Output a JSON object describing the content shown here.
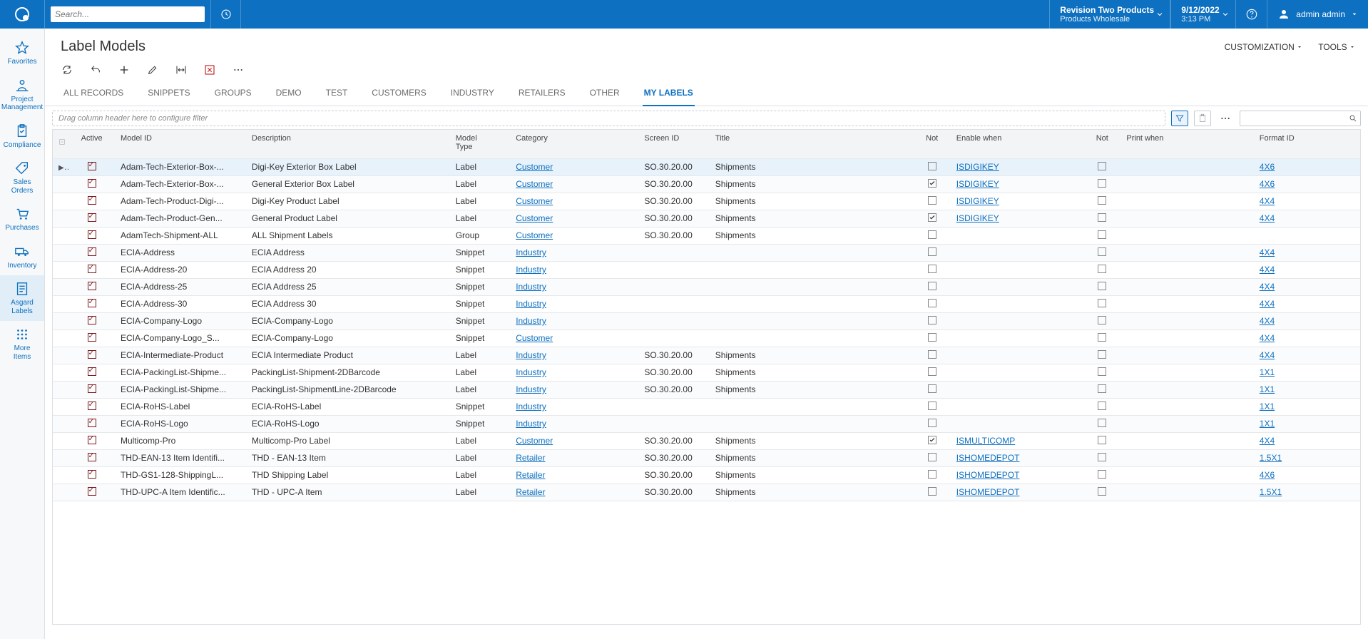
{
  "top": {
    "search_placeholder": "Search...",
    "company_line1": "Revision Two Products",
    "company_line2": "Products Wholesale",
    "date": "9/12/2022",
    "time": "3:13 PM",
    "user": "admin admin"
  },
  "sidebar": [
    {
      "label": "Favorites",
      "icon": "star"
    },
    {
      "label": "Project Management",
      "icon": "pm"
    },
    {
      "label": "Compliance",
      "icon": "clip"
    },
    {
      "label": "Sales Orders",
      "icon": "tag"
    },
    {
      "label": "Purchases",
      "icon": "cart"
    },
    {
      "label": "Inventory",
      "icon": "truck"
    },
    {
      "label": "Asgard Labels",
      "icon": "doc",
      "active": true
    },
    {
      "label": "More Items",
      "icon": "grid"
    }
  ],
  "page": {
    "title": "Label Models",
    "actions": {
      "customization": "CUSTOMIZATION",
      "tools": "TOOLS"
    },
    "tabs": [
      "ALL RECORDS",
      "SNIPPETS",
      "GROUPS",
      "DEMO",
      "TEST",
      "CUSTOMERS",
      "INDUSTRY",
      "RETAILERS",
      "OTHER",
      "MY LABELS"
    ],
    "active_tab": 9,
    "drag_hint": "Drag column header here to configure filter"
  },
  "columns": [
    "",
    "Active",
    "Model ID",
    "Description",
    "Model Type",
    "Category",
    "Screen ID",
    "Title",
    "Not",
    "Enable when",
    "Not",
    "Print when",
    "Format ID"
  ],
  "rows": [
    {
      "active": true,
      "model_id": "Adam-Tech-Exterior-Box-...",
      "desc": "Digi-Key Exterior Box Label",
      "type": "Label",
      "category": "Customer",
      "screen": "SO.30.20.00",
      "title": "Shipments",
      "not1": false,
      "enable": "ISDIGIKEY",
      "not2": false,
      "print": "",
      "format": "4X6",
      "selected": true
    },
    {
      "active": true,
      "model_id": "Adam-Tech-Exterior-Box-...",
      "desc": "General Exterior Box Label",
      "type": "Label",
      "category": "Customer",
      "screen": "SO.30.20.00",
      "title": "Shipments",
      "not1": true,
      "enable": "ISDIGIKEY",
      "not2": false,
      "print": "",
      "format": "4X6"
    },
    {
      "active": true,
      "model_id": "Adam-Tech-Product-Digi-...",
      "desc": "Digi-Key Product Label",
      "type": "Label",
      "category": "Customer",
      "screen": "SO.30.20.00",
      "title": "Shipments",
      "not1": false,
      "enable": "ISDIGIKEY",
      "not2": false,
      "print": "",
      "format": "4X4"
    },
    {
      "active": true,
      "model_id": "Adam-Tech-Product-Gen...",
      "desc": "General Product Label",
      "type": "Label",
      "category": "Customer",
      "screen": "SO.30.20.00",
      "title": "Shipments",
      "not1": true,
      "enable": "ISDIGIKEY",
      "not2": false,
      "print": "",
      "format": "4X4"
    },
    {
      "active": true,
      "model_id": "AdamTech-Shipment-ALL",
      "desc": "ALL Shipment Labels",
      "type": "Group",
      "category": "Customer",
      "screen": "SO.30.20.00",
      "title": "Shipments",
      "not1": false,
      "enable": "",
      "not2": false,
      "print": "",
      "format": ""
    },
    {
      "active": true,
      "model_id": "ECIA-Address",
      "desc": "ECIA Address",
      "type": "Snippet",
      "category": "Industry",
      "screen": "",
      "title": "",
      "not1": false,
      "enable": "",
      "not2": false,
      "print": "",
      "format": "4X4"
    },
    {
      "active": true,
      "model_id": "ECIA-Address-20",
      "desc": "ECIA Address 20",
      "type": "Snippet",
      "category": "Industry",
      "screen": "",
      "title": "",
      "not1": false,
      "enable": "",
      "not2": false,
      "print": "",
      "format": "4X4"
    },
    {
      "active": true,
      "model_id": "ECIA-Address-25",
      "desc": "ECIA Address 25",
      "type": "Snippet",
      "category": "Industry",
      "screen": "",
      "title": "",
      "not1": false,
      "enable": "",
      "not2": false,
      "print": "",
      "format": "4X4"
    },
    {
      "active": true,
      "model_id": "ECIA-Address-30",
      "desc": "ECIA Address 30",
      "type": "Snippet",
      "category": "Industry",
      "screen": "",
      "title": "",
      "not1": false,
      "enable": "",
      "not2": false,
      "print": "",
      "format": "4X4"
    },
    {
      "active": true,
      "model_id": "ECIA-Company-Logo",
      "desc": "ECIA-Company-Logo",
      "type": "Snippet",
      "category": "Industry",
      "screen": "",
      "title": "",
      "not1": false,
      "enable": "",
      "not2": false,
      "print": "",
      "format": "4X4"
    },
    {
      "active": true,
      "model_id": "ECIA-Company-Logo_S...",
      "desc": "ECIA-Company-Logo",
      "type": "Snippet",
      "category": "Customer",
      "screen": "",
      "title": "",
      "not1": false,
      "enable": "",
      "not2": false,
      "print": "",
      "format": "4X4"
    },
    {
      "active": true,
      "model_id": "ECIA-Intermediate-Product",
      "desc": "ECIA Intermediate Product",
      "type": "Label",
      "category": "Industry",
      "screen": "SO.30.20.00",
      "title": "Shipments",
      "not1": false,
      "enable": "",
      "not2": false,
      "print": "",
      "format": "4X4"
    },
    {
      "active": true,
      "model_id": "ECIA-PackingList-Shipme...",
      "desc": "PackingList-Shipment-2DBarcode",
      "type": "Label",
      "category": "Industry",
      "screen": "SO.30.20.00",
      "title": "Shipments",
      "not1": false,
      "enable": "",
      "not2": false,
      "print": "",
      "format": "1X1"
    },
    {
      "active": true,
      "model_id": "ECIA-PackingList-Shipme...",
      "desc": "PackingList-ShipmentLine-2DBarcode",
      "type": "Label",
      "category": "Industry",
      "screen": "SO.30.20.00",
      "title": "Shipments",
      "not1": false,
      "enable": "",
      "not2": false,
      "print": "",
      "format": "1X1"
    },
    {
      "active": true,
      "model_id": "ECIA-RoHS-Label",
      "desc": "ECIA-RoHS-Label",
      "type": "Snippet",
      "category": "Industry",
      "screen": "",
      "title": "",
      "not1": false,
      "enable": "",
      "not2": false,
      "print": "",
      "format": "1X1"
    },
    {
      "active": true,
      "model_id": "ECIA-RoHS-Logo",
      "desc": "ECIA-RoHS-Logo",
      "type": "Snippet",
      "category": "Industry",
      "screen": "",
      "title": "",
      "not1": false,
      "enable": "",
      "not2": false,
      "print": "",
      "format": "1X1"
    },
    {
      "active": true,
      "model_id": "Multicomp-Pro",
      "desc": "Multicomp-Pro Label",
      "type": "Label",
      "category": "Customer",
      "screen": "SO.30.20.00",
      "title": "Shipments",
      "not1": true,
      "enable": "ISMULTICOMP",
      "not2": false,
      "print": "",
      "format": "4X4"
    },
    {
      "active": true,
      "model_id": "THD-EAN-13 Item Identifi...",
      "desc": "THD - EAN-13 Item",
      "type": "Label",
      "category": "Retailer",
      "screen": "SO.30.20.00",
      "title": "Shipments",
      "not1": false,
      "enable": "ISHOMEDEPOT",
      "not2": false,
      "print": "",
      "format": "1.5X1"
    },
    {
      "active": true,
      "model_id": "THD-GS1-128-ShippingL...",
      "desc": "THD Shipping Label",
      "type": "Label",
      "category": "Retailer",
      "screen": "SO.30.20.00",
      "title": "Shipments",
      "not1": false,
      "enable": "ISHOMEDEPOT",
      "not2": false,
      "print": "",
      "format": "4X6"
    },
    {
      "active": true,
      "model_id": "THD-UPC-A Item Identific...",
      "desc": "THD - UPC-A Item",
      "type": "Label",
      "category": "Retailer",
      "screen": "SO.30.20.00",
      "title": "Shipments",
      "not1": false,
      "enable": "ISHOMEDEPOT",
      "not2": false,
      "print": "",
      "format": "1.5X1"
    }
  ]
}
